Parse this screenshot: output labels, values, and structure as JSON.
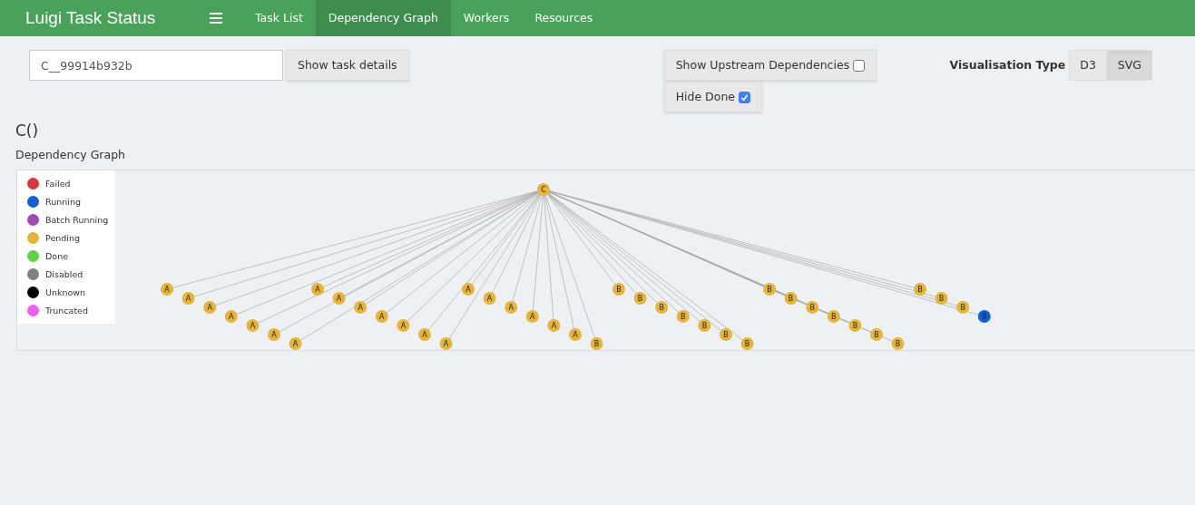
{
  "navbar": {
    "brand": "Luigi Task Status",
    "links": [
      {
        "label": "Task List",
        "selected": false
      },
      {
        "label": "Dependency Graph",
        "selected": true
      },
      {
        "label": "Workers",
        "selected": false
      },
      {
        "label": "Resources",
        "selected": false
      }
    ]
  },
  "search": {
    "value": "C__99914b932b",
    "button": "Show task details"
  },
  "options": [
    {
      "label": "Show Upstream Dependencies",
      "checked": false
    },
    {
      "label": "Hide Done",
      "checked": true
    }
  ],
  "visualisation": {
    "label": "Visualisation Type",
    "choices": [
      {
        "label": "D3",
        "selected": false
      },
      {
        "label": "SVG",
        "selected": true
      }
    ]
  },
  "task_title": "C()",
  "graph_title": "Dependency Graph",
  "legend": [
    {
      "label": "Failed",
      "color": "#d9363e"
    },
    {
      "label": "Running",
      "color": "#0f5fd6"
    },
    {
      "label": "Batch Running",
      "color": "#a04ab8"
    },
    {
      "label": "Pending",
      "color": "#e5b53a"
    },
    {
      "label": "Done",
      "color": "#5fd444"
    },
    {
      "label": "Disabled",
      "color": "#808080"
    },
    {
      "label": "Unknown",
      "color": "#000000"
    },
    {
      "label": "Truncated",
      "color": "#f05ef0"
    }
  ],
  "graph": {
    "root": {
      "label": "C",
      "color": "#e5b53a"
    },
    "groups": [
      {
        "nodes": [
          {
            "label": "A",
            "color": "#e5b53a"
          },
          {
            "label": "A",
            "color": "#e5b53a"
          },
          {
            "label": "A",
            "color": "#e5b53a"
          },
          {
            "label": "A",
            "color": "#e5b53a"
          },
          {
            "label": "A",
            "color": "#e5b53a"
          },
          {
            "label": "A",
            "color": "#e5b53a"
          },
          {
            "label": "A",
            "color": "#e5b53a"
          }
        ]
      },
      {
        "nodes": [
          {
            "label": "A",
            "color": "#e5b53a"
          },
          {
            "label": "A",
            "color": "#e5b53a"
          },
          {
            "label": "A",
            "color": "#e5b53a"
          },
          {
            "label": "A",
            "color": "#e5b53a"
          },
          {
            "label": "A",
            "color": "#e5b53a"
          },
          {
            "label": "A",
            "color": "#e5b53a"
          },
          {
            "label": "A",
            "color": "#e5b53a"
          }
        ]
      },
      {
        "nodes": [
          {
            "label": "A",
            "color": "#e5b53a"
          },
          {
            "label": "A",
            "color": "#e5b53a"
          },
          {
            "label": "A",
            "color": "#e5b53a"
          },
          {
            "label": "A",
            "color": "#e5b53a"
          },
          {
            "label": "A",
            "color": "#e5b53a"
          },
          {
            "label": "A",
            "color": "#e5b53a"
          },
          {
            "label": "B",
            "color": "#e5b53a"
          }
        ]
      },
      {
        "nodes": [
          {
            "label": "B",
            "color": "#e5b53a"
          },
          {
            "label": "B",
            "color": "#e5b53a"
          },
          {
            "label": "B",
            "color": "#e5b53a"
          },
          {
            "label": "B",
            "color": "#e5b53a"
          },
          {
            "label": "B",
            "color": "#e5b53a"
          },
          {
            "label": "B",
            "color": "#e5b53a"
          },
          {
            "label": "B",
            "color": "#e5b53a"
          }
        ]
      },
      {
        "nodes": [
          {
            "label": "B",
            "color": "#e5b53a"
          },
          {
            "label": "B",
            "color": "#e5b53a"
          },
          {
            "label": "B",
            "color": "#e5b53a"
          },
          {
            "label": "B",
            "color": "#e5b53a"
          },
          {
            "label": "B",
            "color": "#e5b53a"
          },
          {
            "label": "B",
            "color": "#e5b53a"
          },
          {
            "label": "B",
            "color": "#e5b53a"
          }
        ]
      },
      {
        "nodes": [
          {
            "label": "B",
            "color": "#e5b53a"
          },
          {
            "label": "B",
            "color": "#e5b53a"
          },
          {
            "label": "B",
            "color": "#e5b53a"
          },
          {
            "label": "B",
            "color": "#0f5fd6"
          }
        ]
      }
    ]
  }
}
